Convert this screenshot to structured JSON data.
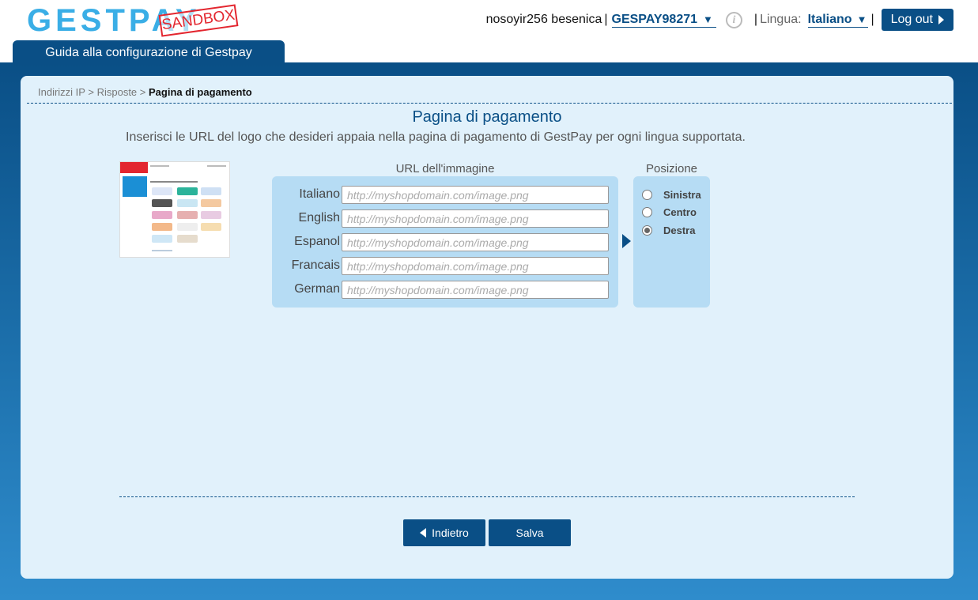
{
  "header": {
    "logo_text": "GESTPAY",
    "sandbox_label": "SANDBOX",
    "user_name": "nosoyir256 besenica",
    "merchant_code": "GESPAY98271",
    "lingua_label": "Lingua:",
    "language": "Italiano",
    "logout_label": "Log out"
  },
  "tab": {
    "guide_label": "Guida alla configurazione di Gestpay"
  },
  "breadcrumb": {
    "items": [
      "Indirizzi IP",
      "Risposte"
    ],
    "separator": ">",
    "current": "Pagina di pagamento"
  },
  "page": {
    "title": "Pagina di pagamento",
    "description": "Inserisci le URL del logo che desideri appaia nella pagina di pagamento di GestPay per ogni lingua supportata."
  },
  "url_section": {
    "header": "URL dell'immagine",
    "rows": [
      {
        "label": "Italiano",
        "value": "",
        "placeholder": "http://myshopdomain.com/image.png"
      },
      {
        "label": "English",
        "value": "",
        "placeholder": "http://myshopdomain.com/image.png"
      },
      {
        "label": "Espanol",
        "value": "",
        "placeholder": "http://myshopdomain.com/image.png"
      },
      {
        "label": "Francais",
        "value": "",
        "placeholder": "http://myshopdomain.com/image.png"
      },
      {
        "label": "German",
        "value": "",
        "placeholder": "http://myshopdomain.com/image.png"
      }
    ]
  },
  "position_section": {
    "header": "Posizione",
    "options": [
      {
        "label": "Sinistra",
        "checked": false
      },
      {
        "label": "Centro",
        "checked": false
      },
      {
        "label": "Destra",
        "checked": true
      }
    ]
  },
  "buttons": {
    "back_label": "Indietro",
    "save_label": "Salva"
  },
  "colors": {
    "brand_dark": "#0a4f86",
    "brand_light": "#3aaee6",
    "panel_bg": "#e1f1fb",
    "box_bg": "#b6dcf4",
    "sandbox_red": "#e3262f"
  },
  "icons": {
    "info": "info-icon",
    "dropdown": "chevron-down-icon",
    "logout": "triangle-right-icon",
    "back": "triangle-left-icon",
    "pointer": "triangle-right-icon"
  }
}
